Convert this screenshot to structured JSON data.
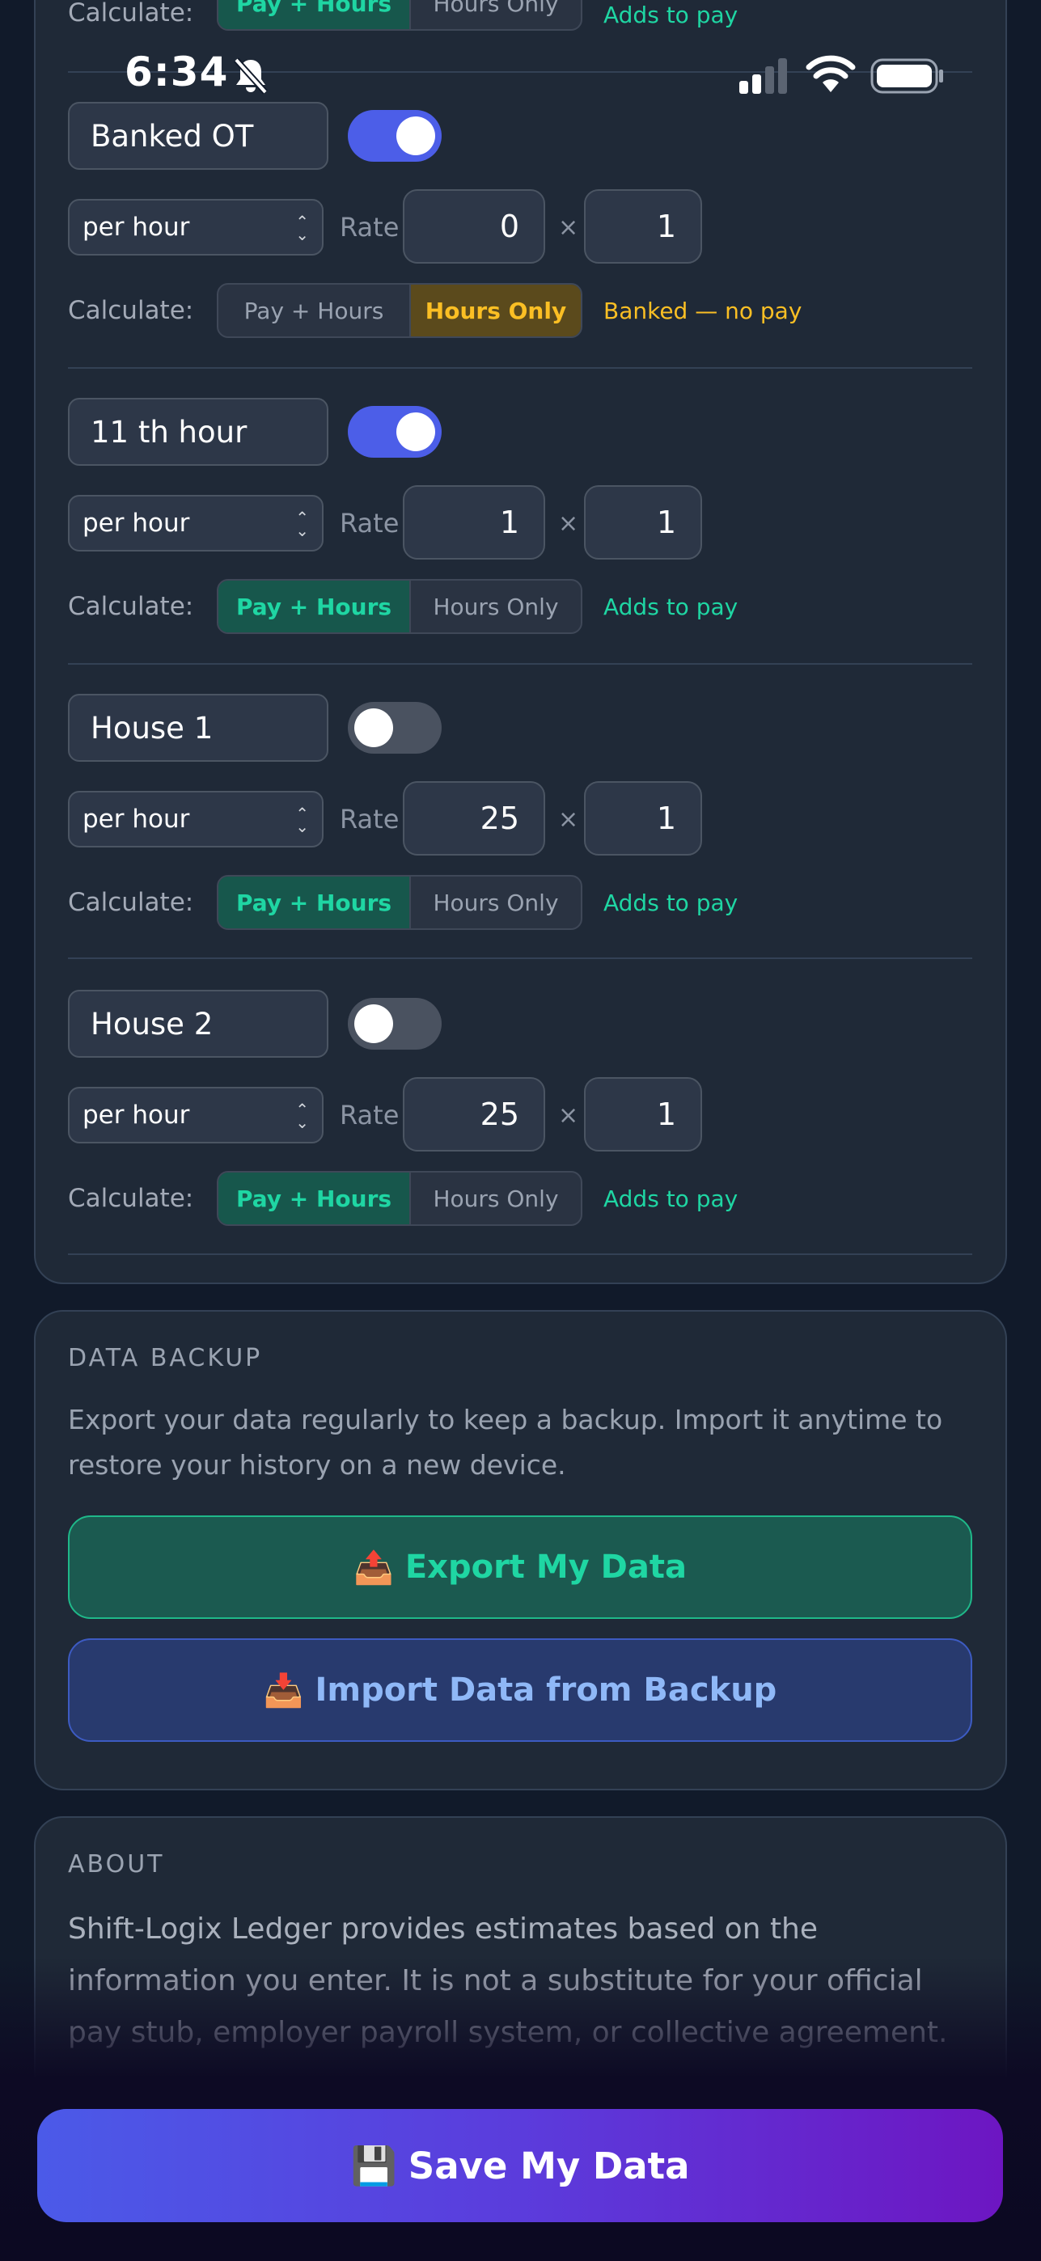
{
  "status_bar": {
    "time": "6:34"
  },
  "top_partial": {
    "calc_label": "Calculate:",
    "option_pay": "Pay + Hours",
    "option_hours": "Hours Only",
    "note": "Adds to pay"
  },
  "rows": [
    {
      "name": "Banked OT",
      "enabled": true,
      "unit": "per hour",
      "rate_label": "Rate",
      "rate": "0",
      "times": "×",
      "multiplier": "1",
      "calc_label": "Calculate:",
      "option_pay": "Pay + Hours",
      "option_hours": "Hours Only",
      "mode": "hours",
      "note": "Banked — no pay"
    },
    {
      "name": "11 th hour",
      "enabled": true,
      "unit": "per hour",
      "rate_label": "Rate",
      "rate": "1",
      "times": "×",
      "multiplier": "1",
      "calc_label": "Calculate:",
      "option_pay": "Pay + Hours",
      "option_hours": "Hours Only",
      "mode": "pay",
      "note": "Adds to pay"
    },
    {
      "name": "House 1",
      "enabled": false,
      "unit": "per hour",
      "rate_label": "Rate",
      "rate": "25",
      "times": "×",
      "multiplier": "1",
      "calc_label": "Calculate:",
      "option_pay": "Pay + Hours",
      "option_hours": "Hours Only",
      "mode": "pay",
      "note": "Adds to pay"
    },
    {
      "name": "House 2",
      "enabled": false,
      "unit": "per hour",
      "rate_label": "Rate",
      "rate": "25",
      "times": "×",
      "multiplier": "1",
      "calc_label": "Calculate:",
      "option_pay": "Pay + Hours",
      "option_hours": "Hours Only",
      "mode": "pay",
      "note": "Adds to pay"
    }
  ],
  "backup": {
    "title": "DATA BACKUP",
    "description": "Export your data regularly to keep a backup. Import it anytime to restore your history on a new device.",
    "export_icon": "📤",
    "export_label": "Export My Data",
    "import_icon": "📥",
    "import_label": "Import Data from Backup"
  },
  "about": {
    "title": "ABOUT",
    "text": "Shift-Logix Ledger provides estimates based on the information you enter. It is not a substitute for your official pay stub, employer payroll system, or collective agreement."
  },
  "save": {
    "icon": "💾",
    "label": "Save My Data"
  },
  "colors": {
    "accent_pay": "#1fd6a3",
    "accent_bank": "#fbbf24",
    "toggle_on": "#4c5ee8",
    "save_gradient_start": "#4b5ae8",
    "save_gradient_end": "#6d16c2"
  }
}
